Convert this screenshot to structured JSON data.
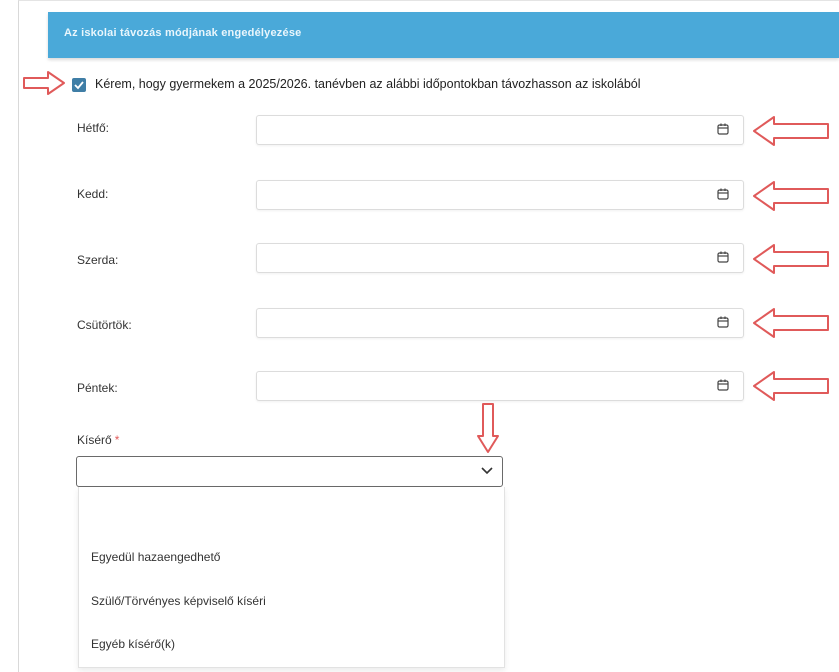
{
  "section": {
    "title": "Az iskolai távozás módjának engedélyezése"
  },
  "consent": {
    "checked": true,
    "label": "Kérem, hogy gyermekem a 2025/2026. tanévben az alábbi időpontokban távozhasson az iskolából"
  },
  "days": [
    {
      "label": "Hétfő:",
      "value": ""
    },
    {
      "label": "Kedd:",
      "value": ""
    },
    {
      "label": "Szerda:",
      "value": ""
    },
    {
      "label": "Csütörtök:",
      "value": ""
    },
    {
      "label": "Péntek:",
      "value": ""
    }
  ],
  "escort": {
    "label": "Kísérő",
    "required_mark": "*",
    "selected": "",
    "options": [
      "Egyedül hazaengedhető",
      "Szülő/Törvényes képviselő kíséri",
      "Egyéb kísérő(k)"
    ]
  },
  "colors": {
    "header": "#4aa9d9",
    "checkbox": "#3f7ea6",
    "annotation_arrow": "#e05a5a"
  },
  "icons": {
    "date": "calendar-icon",
    "select": "chevron-down-icon",
    "annotation": "arrow-annotation-icon"
  }
}
